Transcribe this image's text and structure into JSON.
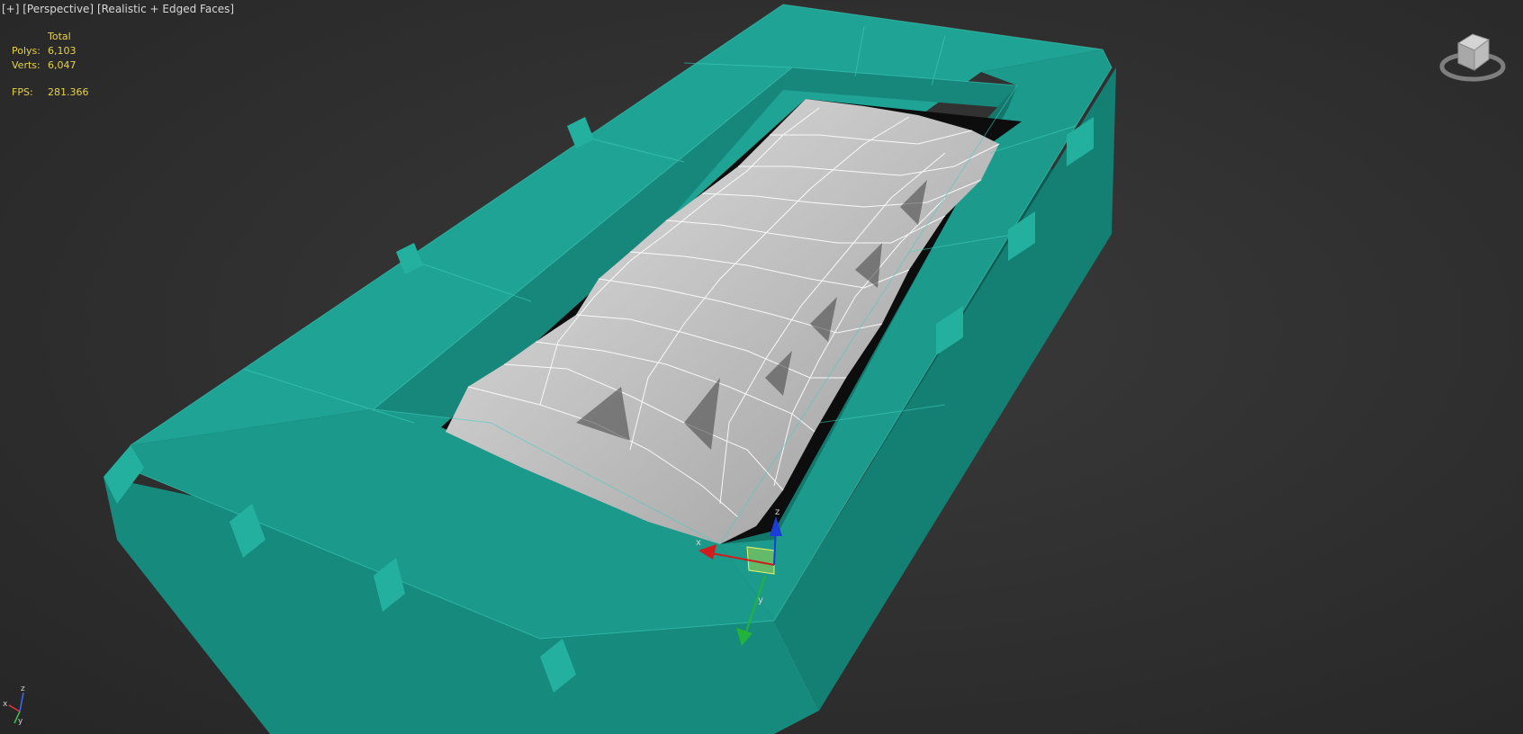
{
  "viewport": {
    "menu": "[+]",
    "view": "[Perspective]",
    "shading": "[Realistic + Edged Faces]"
  },
  "stats": {
    "header": "Total",
    "polys_label": "Polys:",
    "polys_value": "6,103",
    "verts_label": "Verts:",
    "verts_value": "6,047",
    "fps_label": "FPS:",
    "fps_value": "281.366"
  },
  "gizmo": {
    "x_label": "x",
    "y_label": "y",
    "z_label": "z"
  },
  "tripod": {
    "x_label": "x",
    "y_label": "y",
    "z_label": "z"
  },
  "colors": {
    "container": "#1fa394",
    "container_dark": "#126e63",
    "container_light": "#27b3a2",
    "rocks": "#c9c9c9",
    "stats_text": "#e6d24a",
    "gizmo_x": "#d01c1c",
    "gizmo_y": "#22b33a",
    "gizmo_z": "#1c3cd8",
    "gizmo_plane": "#c8e84a"
  },
  "icons": {
    "viewcube": "viewcube-icon",
    "tripod": "axis-tripod-icon",
    "gizmo": "move-gizmo-icon"
  }
}
